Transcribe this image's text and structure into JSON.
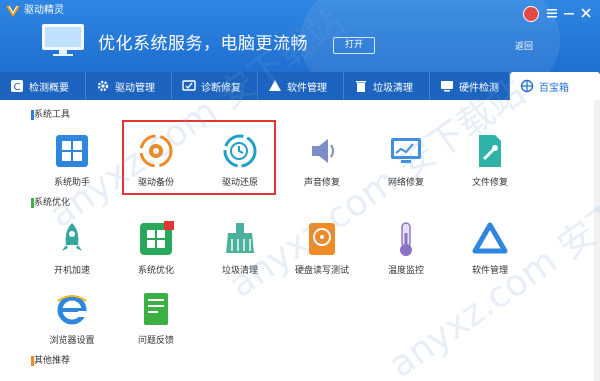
{
  "app": {
    "title": "驱动精灵"
  },
  "header": {
    "slogan": "优化系统服务，电脑更流畅",
    "open_label": "打开",
    "back_label": "返回"
  },
  "tabs": [
    {
      "label": "检测概要",
      "icon": "overview-icon"
    },
    {
      "label": "驱动管理",
      "icon": "driver-gear-icon"
    },
    {
      "label": "诊断修复",
      "icon": "diagnose-icon"
    },
    {
      "label": "软件管理",
      "icon": "software-icon"
    },
    {
      "label": "垃圾清理",
      "icon": "trash-icon"
    },
    {
      "label": "硬件检测",
      "icon": "hardware-icon"
    },
    {
      "label": "百宝箱",
      "icon": "toolbox-icon"
    }
  ],
  "sections": {
    "system_tools": "系统工具",
    "system_optimize": "系统优化",
    "other_recommend": "其他推荐"
  },
  "tools": {
    "row1": [
      {
        "label": "系统助手",
        "icon": "windows-icon"
      },
      {
        "label": "驱动备份",
        "icon": "driver-backup-icon"
      },
      {
        "label": "驱动还原",
        "icon": "driver-restore-icon"
      },
      {
        "label": "声音修复",
        "icon": "speaker-icon"
      },
      {
        "label": "网络修复",
        "icon": "network-icon"
      },
      {
        "label": "文件修复",
        "icon": "file-repair-icon"
      }
    ],
    "row2": [
      {
        "label": "开机加速",
        "icon": "rocket-icon"
      },
      {
        "label": "系统优化",
        "icon": "system-optimize-icon"
      },
      {
        "label": "垃圾清理",
        "icon": "broom-icon"
      },
      {
        "label": "硬盘读写测试",
        "icon": "disk-icon"
      },
      {
        "label": "温度监控",
        "icon": "thermometer-icon"
      },
      {
        "label": "软件管理",
        "icon": "software-manage-icon"
      }
    ],
    "row3": [
      {
        "label": "浏览器设置",
        "icon": "ie-browser-icon"
      },
      {
        "label": "问题反馈",
        "icon": "feedback-icon"
      }
    ]
  },
  "colors": {
    "primary": "#1f6fd0",
    "highlight": "#e53434",
    "section_blue": "#2d7fe0",
    "section_green": "#3cb043",
    "section_orange": "#f08a24"
  },
  "watermark": "anyxz.com 安下载站"
}
